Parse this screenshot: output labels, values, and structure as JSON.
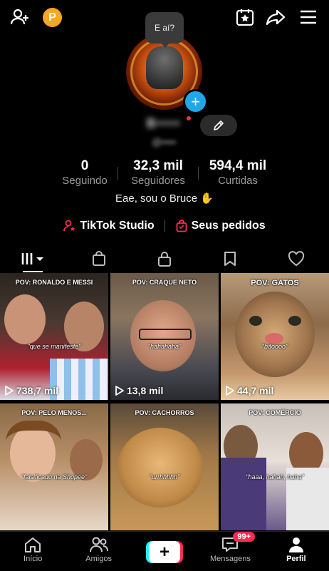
{
  "header": {
    "add_friend_icon": "add-user-icon",
    "points_badge": "P",
    "calendar_icon": "calendar-star-icon",
    "share_icon": "share-icon",
    "menu_icon": "hamburger-menu-icon"
  },
  "profile": {
    "bubble_text": "E aí?",
    "username": "B••••",
    "handle": "@••••",
    "bio": "Eae, sou o Bruce ✋"
  },
  "stats": [
    {
      "value": "0",
      "label": "Seguindo"
    },
    {
      "value": "32,3 mil",
      "label": "Seguidores"
    },
    {
      "value": "594,4 mil",
      "label": "Curtidas"
    }
  ],
  "links": {
    "studio": "TikTok Studio",
    "orders": "Seus pedidos"
  },
  "tabs": [
    "videos",
    "shop",
    "private",
    "favorites",
    "liked"
  ],
  "videos": [
    {
      "caption": "POV: RONALDO E MESSI",
      "subtitle": "\"que se manifeste\"",
      "views": "738,7 mil"
    },
    {
      "caption": "POV: CRAQUE NETO",
      "subtitle": "\"hahahaha\"",
      "views": "13,8 mil"
    },
    {
      "caption": "POV: GATOS",
      "subtitle": "\"bãoooo\"",
      "views": "44,7 mil"
    },
    {
      "caption": "POV: PELO MENOS...",
      "subtitle": "\"falsificado na Shopee\"",
      "views": ""
    },
    {
      "caption": "POV: CACHORROS",
      "subtitle": "\"urrhhhhh\"",
      "views": ""
    },
    {
      "caption": "POV: COMÉRCIO",
      "subtitle": "\"haaa, hahah, haha\"",
      "views": ""
    }
  ],
  "bottom_nav": {
    "home": "Início",
    "friends": "Amigos",
    "messages": "Mensagens",
    "messages_badge": "99+",
    "profile": "Perfil"
  },
  "colors": {
    "accent": "#fe2c55",
    "teal": "#25f4ee",
    "plus_blue": "#20a7e8",
    "points": "#f5a623"
  }
}
